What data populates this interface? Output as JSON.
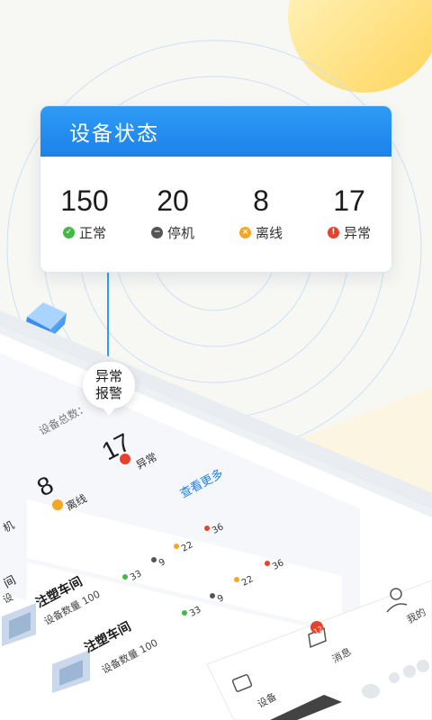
{
  "status_card": {
    "title": "设备状态",
    "items": [
      {
        "value": "150",
        "label": "正常",
        "color": "#43b845",
        "icon": "check-circle-icon"
      },
      {
        "value": "20",
        "label": "停机",
        "color": "#555555",
        "icon": "minus-circle-icon"
      },
      {
        "value": "8",
        "label": "离线",
        "color": "#f5a623",
        "icon": "x-circle-icon"
      },
      {
        "value": "17",
        "label": "异常",
        "color": "#e8412c",
        "icon": "exclamation-circle-icon"
      }
    ]
  },
  "alarm_bubble": {
    "line1": "异常",
    "line2": "报警"
  },
  "phone": {
    "total_label": "设备总数：",
    "stats": [
      {
        "value": "17",
        "label": "异常"
      },
      {
        "value": "8",
        "label": "离线"
      }
    ],
    "partial_label": "机",
    "view_more": "查看更多",
    "workshops": [
      {
        "name": "注塑车间",
        "count_label": "设备数量 100",
        "counts": [
          "33",
          "9",
          "22",
          "36"
        ]
      },
      {
        "name": "注塑车间",
        "count_label": "设备数量 100",
        "counts": [
          "33",
          "9",
          "22",
          "36"
        ]
      }
    ],
    "row_partial": [
      "间",
      "设"
    ],
    "nav": {
      "devices": "设备",
      "messages": "消息",
      "mine": "我的",
      "message_badge": "12"
    }
  },
  "colors": {
    "accent": "#1b82ea",
    "normal": "#43b845",
    "stopped": "#555555",
    "offline": "#f5a623",
    "abnormal": "#e8412c"
  }
}
